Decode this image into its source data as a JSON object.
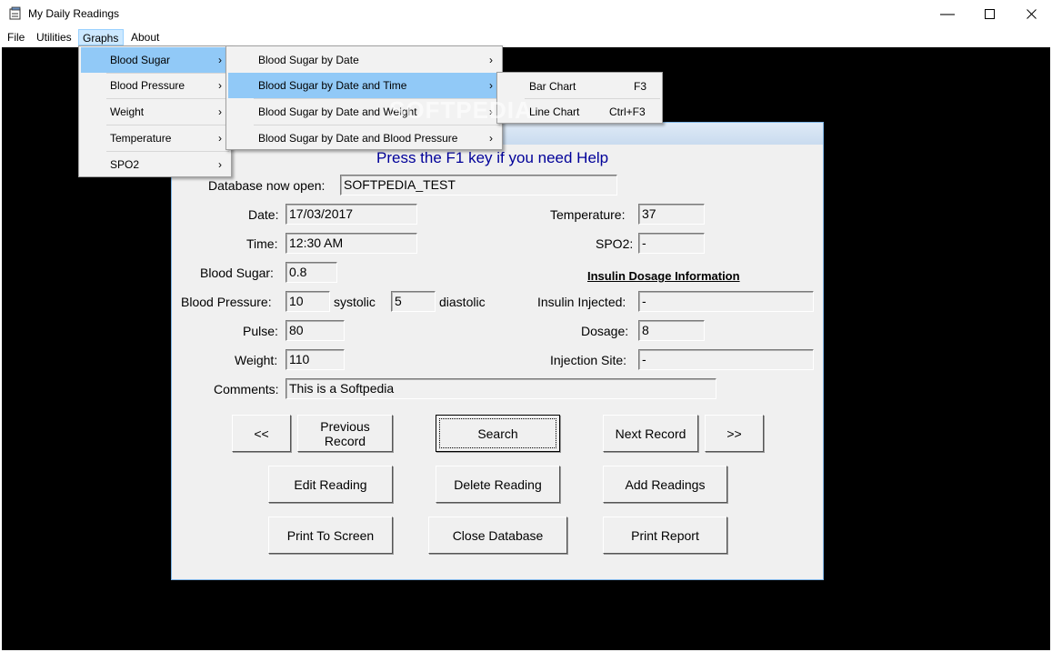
{
  "window": {
    "title": "My Daily Readings"
  },
  "menubar": [
    {
      "label": "File"
    },
    {
      "label": "Utilities"
    },
    {
      "label": "Graphs"
    },
    {
      "label": "About"
    }
  ],
  "graphs_menu": [
    {
      "label": "Blood Sugar"
    },
    {
      "label": "Blood Pressure"
    },
    {
      "label": "Weight"
    },
    {
      "label": "Temperature"
    },
    {
      "label": "SPO2"
    }
  ],
  "blood_sugar_menu": [
    {
      "label": "Blood Sugar by Date"
    },
    {
      "label": "Blood Sugar by Date and Time"
    },
    {
      "label": "Blood Sugar by Date and Weight"
    },
    {
      "label": "Blood Sugar by Date and  Blood Pressure"
    }
  ],
  "chart_menu": [
    {
      "label": "Bar Chart",
      "accel": "F3"
    },
    {
      "label": "Line Chart",
      "accel": "Ctrl+F3"
    }
  ],
  "form": {
    "help_text": "Press the F1 key if you need Help",
    "database_label": "Database now open:",
    "database_value": "SOFTPEDIA_TEST",
    "date_label": "Date:",
    "date_value": "17/03/2017",
    "time_label": "Time:",
    "time_value": "12:30 AM",
    "blood_sugar_label": "Blood Sugar:",
    "blood_sugar_value": "0.8",
    "blood_pressure_label": "Blood Pressure:",
    "systolic_value": "10",
    "systolic_label": "systolic",
    "diastolic_value": "5",
    "diastolic_label": "diastolic",
    "pulse_label": "Pulse:",
    "pulse_value": "80",
    "weight_label": "Weight:",
    "weight_value": "110",
    "comments_label": "Comments:",
    "comments_value": "This is a Softpedia",
    "temperature_label": "Temperature:",
    "temperature_value": "37",
    "spo2_label": "SPO2:",
    "spo2_value": "-",
    "insulin_heading": "Insulin Dosage Information",
    "insulin_injected_label": "Insulin Injected:",
    "insulin_injected_value": "-",
    "dosage_label": "Dosage:",
    "dosage_value": "8",
    "injection_site_label": "Injection Site:",
    "injection_site_value": "-"
  },
  "buttons": {
    "first": "<<",
    "previous": "Previous Record",
    "search": "Search",
    "next": "Next Record",
    "last": ">>",
    "edit": "Edit Reading",
    "delete": "Delete Reading",
    "add": "Add Readings",
    "print_screen": "Print To Screen",
    "close_db": "Close Database",
    "print_report": "Print Report"
  },
  "watermark": "SOFTPEDIA"
}
